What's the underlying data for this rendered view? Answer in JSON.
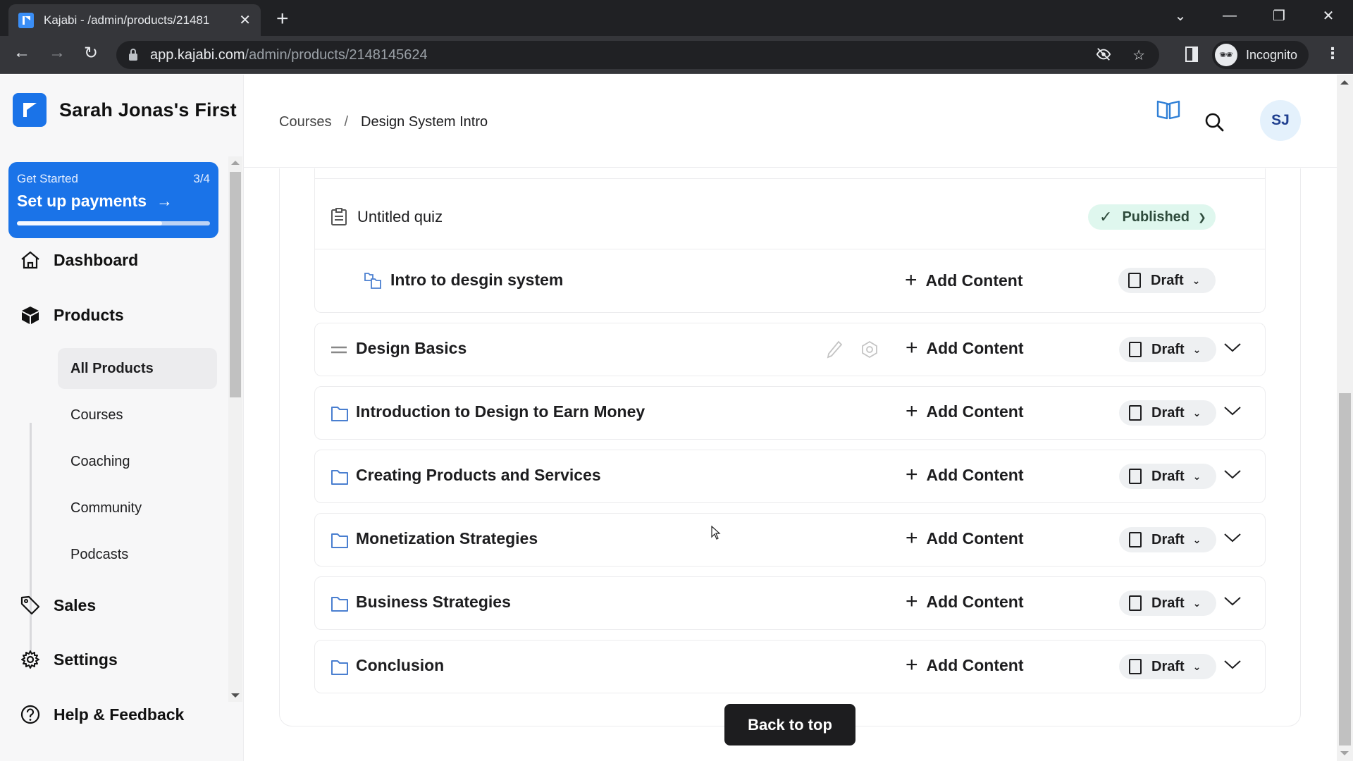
{
  "browser": {
    "tab_title": "Kajabi - /admin/products/21481",
    "new_tab": "+",
    "url_host": "app.kajabi.com",
    "url_path": "/admin/products/2148145624",
    "profile_label": "Incognito"
  },
  "sidebar": {
    "brand_name": "Sarah Jonas's First",
    "get_started": {
      "label": "Get Started",
      "step": "3/4",
      "title": "Set up payments",
      "progress_fraction": 0.75
    },
    "nav": [
      {
        "label": "Dashboard",
        "icon": "home-icon"
      },
      {
        "label": "Products",
        "icon": "box-icon"
      },
      {
        "label": "Sales",
        "icon": "tag-icon"
      },
      {
        "label": "Settings",
        "icon": "gear-icon"
      },
      {
        "label": "Help & Feedback",
        "icon": "help-circle-icon"
      }
    ],
    "products_sub": [
      {
        "label": "All Products",
        "active": true
      },
      {
        "label": "Courses",
        "active": false
      },
      {
        "label": "Coaching",
        "active": false
      },
      {
        "label": "Community",
        "active": false
      },
      {
        "label": "Podcasts",
        "active": false
      }
    ]
  },
  "header": {
    "breadcrumb": [
      {
        "label": "Courses"
      },
      {
        "label": "Design System Intro"
      }
    ],
    "breadcrumb_separator": "/",
    "avatar_initials": "SJ"
  },
  "content": {
    "quiz": {
      "title": "Untitled quiz",
      "status": "Published"
    },
    "lesson": {
      "title": "Intro to desgin system",
      "add_label": "Add Content",
      "status": "Draft"
    },
    "sections": [
      {
        "title": "Design Basics",
        "add_label": "Add Content",
        "status": "Draft",
        "hovered": true
      },
      {
        "title": "Introduction to Design to Earn Money",
        "add_label": "Add Content",
        "status": "Draft"
      },
      {
        "title": "Creating Products and Services",
        "add_label": "Add Content",
        "status": "Draft"
      },
      {
        "title": "Monetization Strategies",
        "add_label": "Add Content",
        "status": "Draft"
      },
      {
        "title": "Business Strategies",
        "add_label": "Add Content",
        "status": "Draft"
      },
      {
        "title": "Conclusion",
        "add_label": "Add Content",
        "status": "Draft"
      }
    ],
    "back_to_top": "Back to top"
  },
  "colors": {
    "brand_blue": "#1a73e8",
    "published_bg": "#dff7ee",
    "published_text": "#2e4b3c",
    "draft_bg": "#eef0f2",
    "folder_icon": "#4a7fd0",
    "back_to_top_bg": "#1d1d1f"
  }
}
